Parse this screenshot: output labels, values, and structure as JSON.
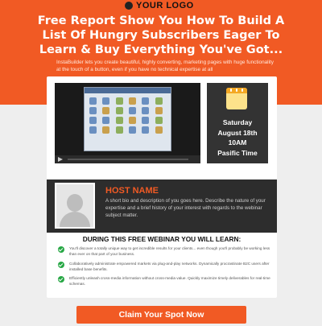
{
  "brand": {
    "logo_text": "YOUR LOGO"
  },
  "hero": {
    "headline": "Free Report Show You How To Build A List Of Hungry Subscribers Eager To Learn & Buy Everything You've Got...",
    "subline": "InstaBuilder lets you create beautiful, highly converting, marketing pages with huge functionality at the touch of a button, even if you have no technical expertise at all"
  },
  "event": {
    "icon": "calendar-icon",
    "day": "Saturday",
    "date": "August 18th",
    "time": "10AM",
    "zone": "Pasific Time"
  },
  "host": {
    "name": "HOST NAME",
    "bio": "A short bio and description of you goes here. Describe the nature of your expertise and a brief history of your interest with regards to the webinar subject matter."
  },
  "learn": {
    "title": "DURING THIS FREE WEBINAR YOU WILL LEARN:",
    "items": [
      "You'll discover a totally unique way to get incredible results for your clients... even though you'll probably be working less than ever on that part of your business.",
      "Collaboratively administrate empowered markets via plug-and-play networks. Dynamically procrastinate B2C users after installed base benefits.",
      "Efficiently unleash cross-media information without cross-media value. Quickly maximize timely deliverables for real-time schemas."
    ]
  },
  "cta": {
    "label": "Claim Your Spot Now"
  },
  "colors": {
    "accent": "#f15a24",
    "dark": "#2d2d2d",
    "check": "#27a745",
    "calendar": "#f4a824"
  }
}
